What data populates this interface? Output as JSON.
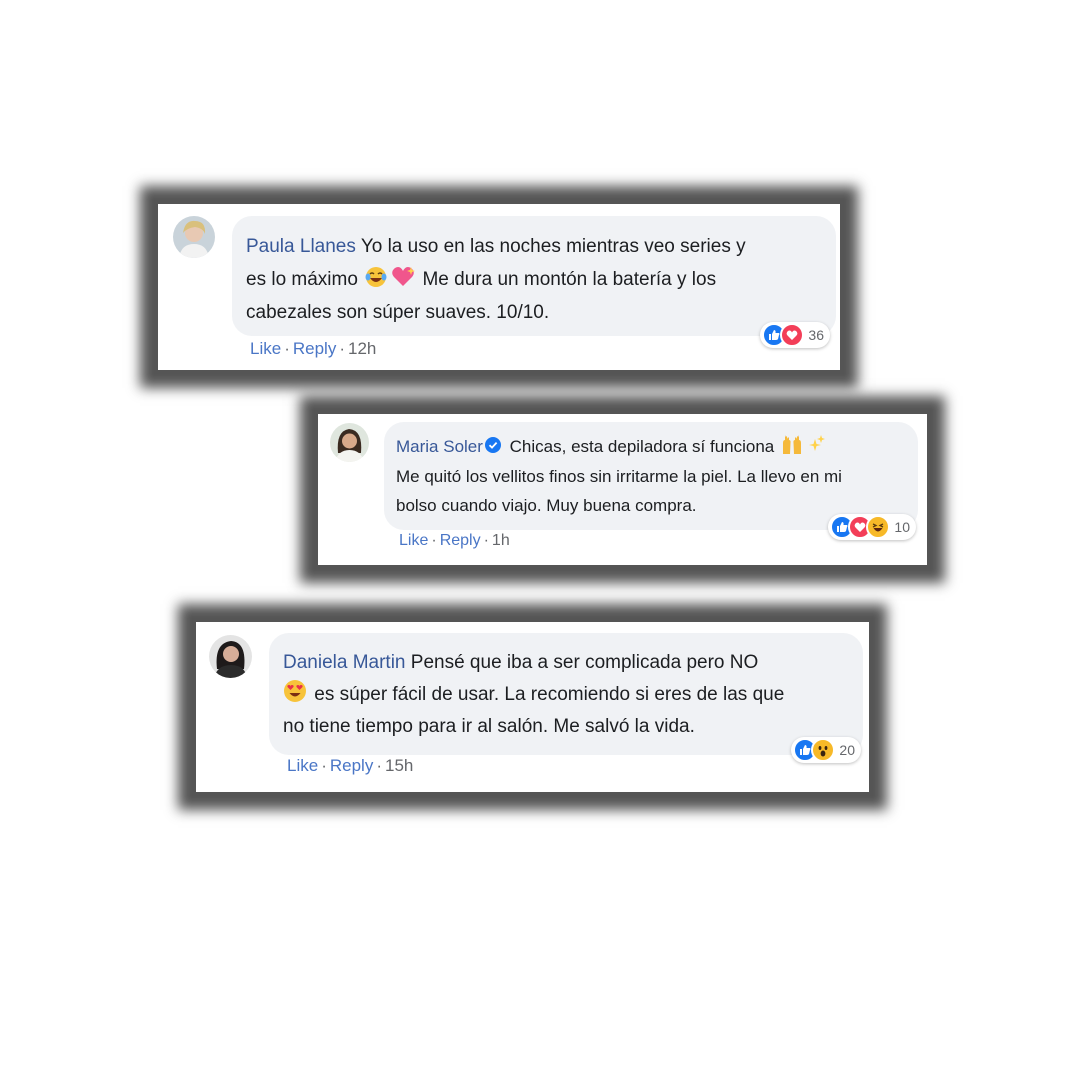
{
  "comments": [
    {
      "author": "Paula Llanes",
      "lines": [
        "Yo la uso en las noches mientras veo series y",
        "es lo máximo",
        "Me dura un montón la batería y los",
        "cabezales son súper suaves. 10/10."
      ],
      "line2_emojis": [
        "face-with-tears-of-joy",
        "sparkling-heart"
      ],
      "reactions": [
        "like",
        "love"
      ],
      "reaction_count": "36",
      "like_label": "Like",
      "reply_label": "Reply",
      "separator": "·",
      "time": "12h"
    },
    {
      "author": "Maria Soler",
      "verified": true,
      "lines": [
        "Chicas, esta depiladora sí funciona",
        "Me quitó los vellitos finos sin irritarme la piel. La llevo en mi",
        "bolso cuando viajo. Muy buena compra."
      ],
      "line1_emojis": [
        "raising-hands",
        "sparkles"
      ],
      "reactions": [
        "like",
        "love",
        "haha"
      ],
      "reaction_count": "10",
      "like_label": "Like",
      "reply_label": "Reply",
      "separator": "·",
      "time": "1h"
    },
    {
      "author": "Daniela Martin",
      "lines": [
        "Pensé que iba a ser complicada pero NO",
        "es súper fácil de usar. La recomiendo si eres de las que",
        "no tiene tiempo para ir al salón. Me salvó la vida."
      ],
      "line2_emojis": [
        "heart-eyes"
      ],
      "reactions": [
        "like",
        "wow"
      ],
      "reaction_count": "20",
      "like_label": "Like",
      "reply_label": "Reply",
      "separator": "·",
      "time": "15h"
    }
  ],
  "colors": {
    "name": "#385898",
    "link": "#4a76c6",
    "bubble": "#f0f2f5",
    "like_blue": "#1877f2",
    "love_red": "#f33e58",
    "emoji_yellow": "#f7b928",
    "frame_shadow": "#464646"
  }
}
